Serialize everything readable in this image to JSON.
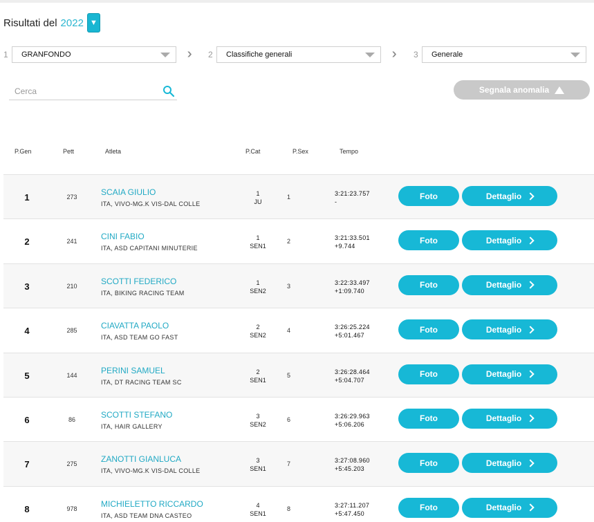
{
  "header": {
    "label": "Risultati del",
    "year": "2022",
    "year_toggle_icon": "triangle-down-icon"
  },
  "steps": [
    {
      "num": "1",
      "value": "GRANFONDO"
    },
    {
      "num": "2",
      "value": "Classifiche generali"
    },
    {
      "num": "3",
      "value": "Generale"
    }
  ],
  "search": {
    "placeholder": "Cerca",
    "value": ""
  },
  "anomaly_button": {
    "label": "Segnala anomalia"
  },
  "columns": {
    "pgen": "P.Gen",
    "pett": "Pett",
    "atleta": "Atleta",
    "pcat": "P.Cat",
    "psex": "P.Sex",
    "tempo": "Tempo"
  },
  "buttons": {
    "foto": "Foto",
    "dettaglio": "Dettaglio"
  },
  "colors": {
    "accent": "#17b8d6",
    "name_link": "#21a9c4",
    "disabled": "#c9c9c9"
  },
  "rows": [
    {
      "pos": "1",
      "pett": "273",
      "name": "SCAIA GIULIO",
      "team": "ITA, VIVO-MG.K VIS-DAL COLLE",
      "cat_pos": "1",
      "cat": "JU",
      "sex": "1",
      "time": "3:21:23.757",
      "gap": "-"
    },
    {
      "pos": "2",
      "pett": "241",
      "name": "CINI FABIO",
      "team": "ITA, ASD CAPITANI MINUTERIE",
      "cat_pos": "1",
      "cat": "SEN1",
      "sex": "2",
      "time": "3:21:33.501",
      "gap": "+9.744"
    },
    {
      "pos": "3",
      "pett": "210",
      "name": "SCOTTI FEDERICO",
      "team": "ITA, BIKING RACING TEAM",
      "cat_pos": "1",
      "cat": "SEN2",
      "sex": "3",
      "time": "3:22:33.497",
      "gap": "+1:09.740"
    },
    {
      "pos": "4",
      "pett": "285",
      "name": "CIAVATTA PAOLO",
      "team": "ITA, ASD TEAM GO FAST",
      "cat_pos": "2",
      "cat": "SEN2",
      "sex": "4",
      "time": "3:26:25.224",
      "gap": "+5:01.467"
    },
    {
      "pos": "5",
      "pett": "144",
      "name": "PERINI SAMUEL",
      "team": "ITA, DT RACING TEAM SC",
      "cat_pos": "2",
      "cat": "SEN1",
      "sex": "5",
      "time": "3:26:28.464",
      "gap": "+5:04.707"
    },
    {
      "pos": "6",
      "pett": "86",
      "name": "SCOTTI STEFANO",
      "team": "ITA, HAIR GALLERY",
      "cat_pos": "3",
      "cat": "SEN2",
      "sex": "6",
      "time": "3:26:29.963",
      "gap": "+5:06.206"
    },
    {
      "pos": "7",
      "pett": "275",
      "name": "ZANOTTI GIANLUCA",
      "team": "ITA, VIVO-MG.K VIS-DAL COLLE",
      "cat_pos": "3",
      "cat": "SEN1",
      "sex": "7",
      "time": "3:27:08.960",
      "gap": "+5:45.203"
    },
    {
      "pos": "8",
      "pett": "978",
      "name": "MICHIELETTO RICCARDO",
      "team": "ITA, ASD TEAM DNA CASTEO",
      "cat_pos": "4",
      "cat": "SEN1",
      "sex": "8",
      "time": "3:27:11.207",
      "gap": "+5:47.450"
    }
  ]
}
